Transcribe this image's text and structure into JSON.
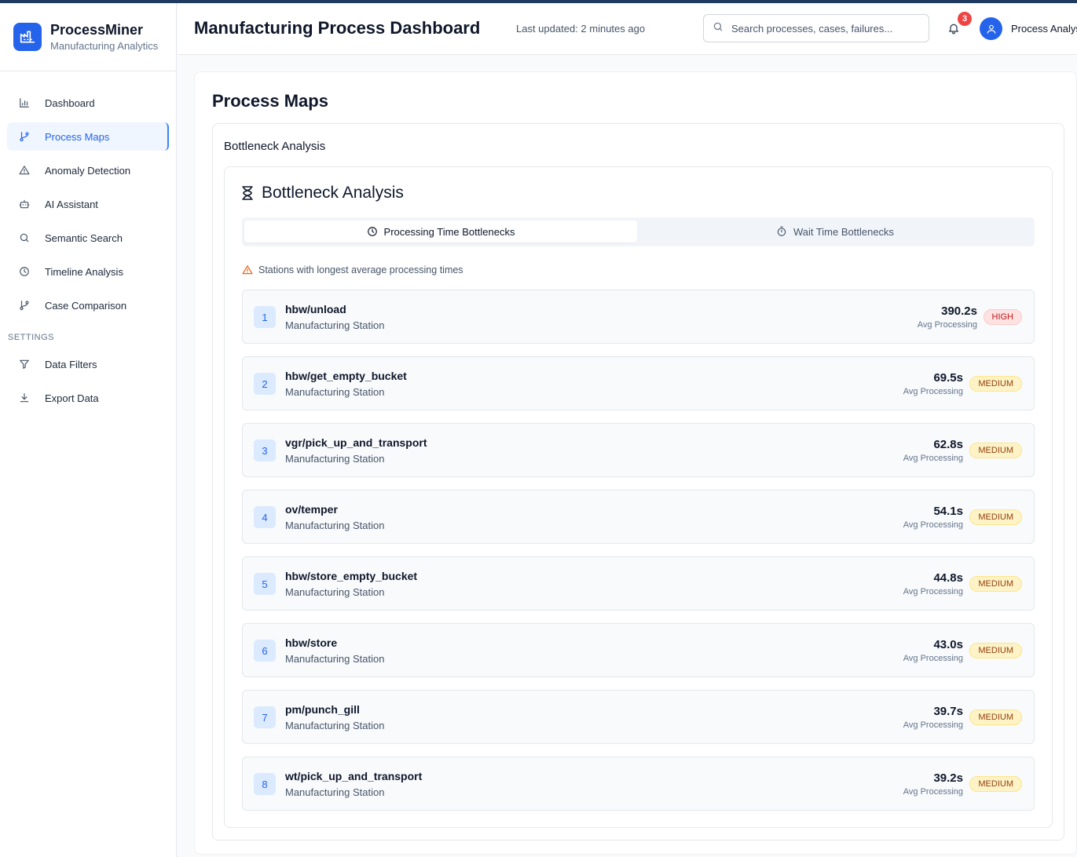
{
  "app": {
    "name": "ProcessMiner",
    "subtitle": "Manufacturing Analytics"
  },
  "sidebar": {
    "items": [
      {
        "label": "Dashboard",
        "icon": "bar-chart-icon"
      },
      {
        "label": "Process Maps",
        "icon": "git-branch-icon",
        "active": true
      },
      {
        "label": "Anomaly Detection",
        "icon": "warning-triangle-icon"
      },
      {
        "label": "AI Assistant",
        "icon": "robot-icon"
      },
      {
        "label": "Semantic Search",
        "icon": "search-icon"
      },
      {
        "label": "Timeline Analysis",
        "icon": "clock-icon"
      },
      {
        "label": "Case Comparison",
        "icon": "git-branch-icon"
      }
    ],
    "settings_heading": "SETTINGS",
    "settings_items": [
      {
        "label": "Data Filters",
        "icon": "filter-icon"
      },
      {
        "label": "Export Data",
        "icon": "download-icon"
      }
    ]
  },
  "header": {
    "title": "Manufacturing Process Dashboard",
    "last_updated": "Last updated: 2 minutes ago",
    "search_placeholder": "Search processes, cases, failures...",
    "notification_count": "3",
    "user_name": "Process Analyst"
  },
  "main": {
    "section_title": "Process Maps",
    "card_title": "Bottleneck Analysis",
    "panel_title": "Bottleneck Analysis",
    "tabs": [
      {
        "label": "Processing Time Bottlenecks",
        "icon": "clock-icon",
        "active": true
      },
      {
        "label": "Wait Time Bottlenecks",
        "icon": "timer-icon",
        "active": false
      }
    ],
    "hint": "Stations with longest average processing times",
    "metric_label": "Avg Processing",
    "station_type": "Manufacturing Station",
    "stations": [
      {
        "rank": "1",
        "name": "hbw/unload",
        "subtitle": "Manufacturing Station",
        "value": "390.2s",
        "metric_label": "Avg Processing",
        "severity": "HIGH"
      },
      {
        "rank": "2",
        "name": "hbw/get_empty_bucket",
        "subtitle": "Manufacturing Station",
        "value": "69.5s",
        "metric_label": "Avg Processing",
        "severity": "MEDIUM"
      },
      {
        "rank": "3",
        "name": "vgr/pick_up_and_transport",
        "subtitle": "Manufacturing Station",
        "value": "62.8s",
        "metric_label": "Avg Processing",
        "severity": "MEDIUM"
      },
      {
        "rank": "4",
        "name": "ov/temper",
        "subtitle": "Manufacturing Station",
        "value": "54.1s",
        "metric_label": "Avg Processing",
        "severity": "MEDIUM"
      },
      {
        "rank": "5",
        "name": "hbw/store_empty_bucket",
        "subtitle": "Manufacturing Station",
        "value": "44.8s",
        "metric_label": "Avg Processing",
        "severity": "MEDIUM"
      },
      {
        "rank": "6",
        "name": "hbw/store",
        "subtitle": "Manufacturing Station",
        "value": "43.0s",
        "metric_label": "Avg Processing",
        "severity": "MEDIUM"
      },
      {
        "rank": "7",
        "name": "pm/punch_gill",
        "subtitle": "Manufacturing Station",
        "value": "39.7s",
        "metric_label": "Avg Processing",
        "severity": "MEDIUM"
      },
      {
        "rank": "8",
        "name": "wt/pick_up_and_transport",
        "subtitle": "Manufacturing Station",
        "value": "39.2s",
        "metric_label": "Avg Processing",
        "severity": "MEDIUM"
      }
    ]
  },
  "colors": {
    "accent": "#2563eb",
    "high_badge_bg": "#fee2e2",
    "high_badge_text": "#b91c1c",
    "medium_badge_bg": "#fef3c7",
    "medium_badge_text": "#92400e",
    "notification_badge": "#ef4444"
  }
}
